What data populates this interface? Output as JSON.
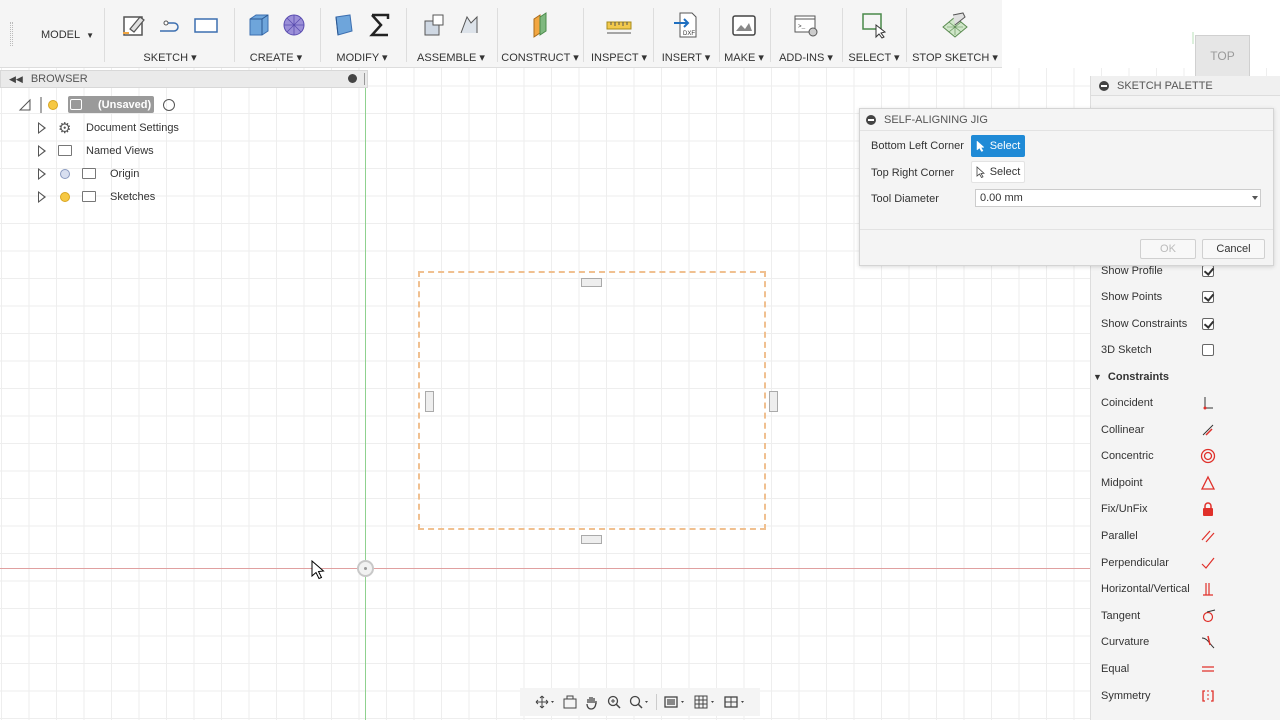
{
  "toolbar": {
    "workspace": "MODEL",
    "groups": [
      {
        "label": "SKETCH ▾"
      },
      {
        "label": "CREATE ▾"
      },
      {
        "label": "MODIFY ▾"
      },
      {
        "label": "ASSEMBLE ▾"
      },
      {
        "label": "CONSTRUCT ▾"
      },
      {
        "label": "INSPECT ▾"
      },
      {
        "label": "INSERT ▾"
      },
      {
        "label": "MAKE ▾"
      },
      {
        "label": "ADD-INS ▾"
      },
      {
        "label": "SELECT ▾"
      },
      {
        "label": "STOP SKETCH ▾"
      }
    ]
  },
  "browser": {
    "title": "BROWSER",
    "root": "(Unsaved)",
    "items": [
      "Document Settings",
      "Named Views",
      "Origin",
      "Sketches"
    ]
  },
  "viewcube": {
    "face": "TOP"
  },
  "palette": {
    "title": "SKETCH PALETTE",
    "options": [
      {
        "label": "Show Profile",
        "checked": true
      },
      {
        "label": "Show Points",
        "checked": true
      },
      {
        "label": "Show Constraints",
        "checked": true
      },
      {
        "label": "3D Sketch",
        "checked": false
      }
    ],
    "constraints_title": "Constraints",
    "constraints": [
      {
        "label": "Coincident",
        "icon": "coincident-icon"
      },
      {
        "label": "Collinear",
        "icon": "collinear-icon"
      },
      {
        "label": "Concentric",
        "icon": "concentric-icon"
      },
      {
        "label": "Midpoint",
        "icon": "midpoint-icon"
      },
      {
        "label": "Fix/UnFix",
        "icon": "lock-icon"
      },
      {
        "label": "Parallel",
        "icon": "parallel-icon"
      },
      {
        "label": "Perpendicular",
        "icon": "perpendicular-icon"
      },
      {
        "label": "Horizontal/Vertical",
        "icon": "horizontal-vertical-icon"
      },
      {
        "label": "Tangent",
        "icon": "tangent-icon"
      },
      {
        "label": "Curvature",
        "icon": "curvature-icon"
      },
      {
        "label": "Equal",
        "icon": "equal-icon"
      },
      {
        "label": "Symmetry",
        "icon": "symmetry-icon"
      }
    ]
  },
  "dialog": {
    "title": "SELF-ALIGNING JIG",
    "bottom_left_label": "Bottom Left Corner",
    "bottom_left_btn": "Select",
    "top_right_label": "Top Right Corner",
    "top_right_btn": "Select",
    "tool_diameter_label": "Tool Diameter",
    "tool_diameter_value": "0.00 mm",
    "ok": "OK",
    "cancel": "Cancel"
  },
  "colors": {
    "accent": "#1f8ad6",
    "constraint": "#e0302a",
    "y_axis": "#8fd18f",
    "x_axis": "#e0a0a0",
    "jig_outline": "#f0c090"
  }
}
